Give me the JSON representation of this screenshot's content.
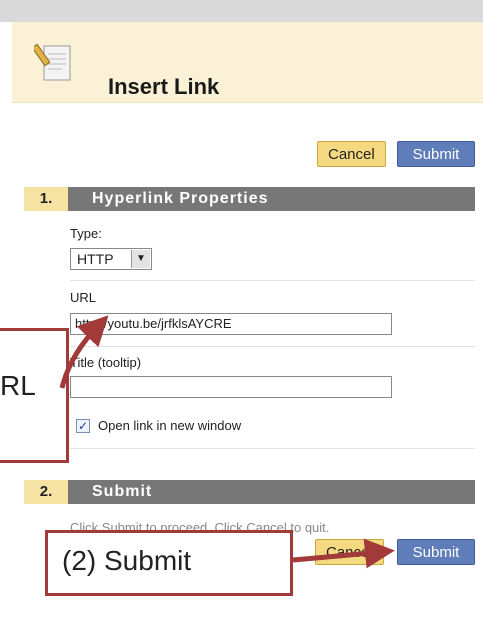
{
  "header": {
    "title": "Insert Link"
  },
  "top_actions": {
    "cancel_label": "Cancel",
    "submit_label": "Submit"
  },
  "section1": {
    "number": "1.",
    "title": "Hyperlink Properties",
    "type_label": "Type:",
    "type_value": "HTTP",
    "url_label": "URL",
    "url_value": "http://youtu.be/jrfklsAYCRE",
    "title_label": "Title (tooltip)",
    "title_value": "",
    "open_new_window_label": "Open link in new window",
    "open_new_window_checked": true
  },
  "section2": {
    "number": "2.",
    "title": "Submit",
    "instructions": "Click Submit to proceed. Click Cancel to quit.",
    "cancel_label": "Cancel",
    "submit_label": "Submit"
  },
  "annotations": {
    "url_partial": "RL",
    "submit_note": "(2) Submit"
  },
  "colors": {
    "header_bg": "#fbf1d6",
    "section_bar": "#777777",
    "submit_button": "#5e7db9",
    "cancel_button": "#f5d981",
    "annotation": "#a23a3a"
  }
}
